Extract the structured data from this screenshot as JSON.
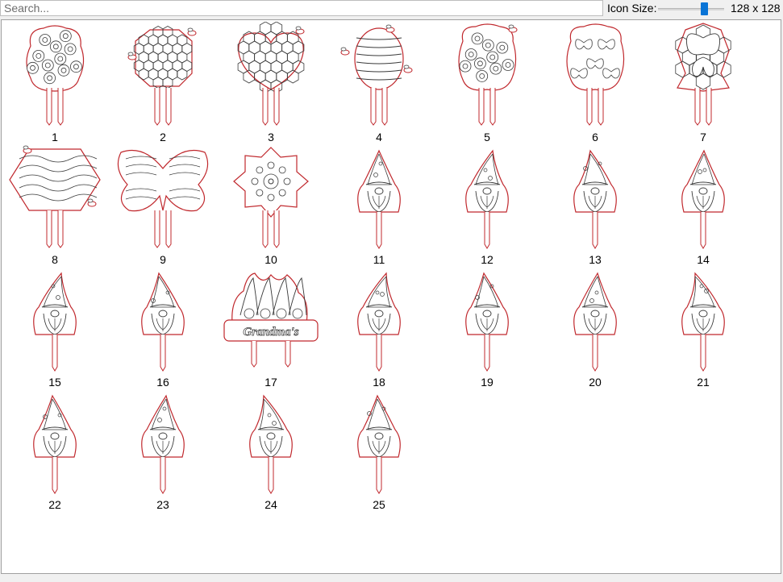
{
  "search": {
    "placeholder": "Search...",
    "value": ""
  },
  "icon_size": {
    "label": "Icon Size:",
    "value_text": "128 x 128",
    "slider_fraction": 0.73
  },
  "stroke_colors": {
    "outer": "#c0282d",
    "inner": "#3a3a3a"
  },
  "items": [
    {
      "label": "1",
      "icon": "sunflower-bouquet-stake"
    },
    {
      "label": "2",
      "icon": "honeycomb-bee-stake"
    },
    {
      "label": "3",
      "icon": "honeycomb-heart-stake"
    },
    {
      "label": "4",
      "icon": "beehive-stake"
    },
    {
      "label": "5",
      "icon": "flower-cluster-stake"
    },
    {
      "label": "6",
      "icon": "butterfly-bouquet-stake"
    },
    {
      "label": "7",
      "icon": "butterfly-honeycomb-stake"
    },
    {
      "label": "8",
      "icon": "hexagon-pattern-stake"
    },
    {
      "label": "9",
      "icon": "butterfly-stake"
    },
    {
      "label": "10",
      "icon": "mandala-flower-stake"
    },
    {
      "label": "11",
      "icon": "gnome-love-stake"
    },
    {
      "label": "12",
      "icon": "gnome-tall-hat-stake"
    },
    {
      "label": "13",
      "icon": "gnome-stake"
    },
    {
      "label": "14",
      "icon": "gnome-flower-stake"
    },
    {
      "label": "15",
      "icon": "gnome-stake"
    },
    {
      "label": "16",
      "icon": "gnome-dotted-hat-stake"
    },
    {
      "label": "17",
      "icon": "gnomes-grandmas-stake"
    },
    {
      "label": "18",
      "icon": "gnome-sunglasses-stake"
    },
    {
      "label": "19",
      "icon": "gnome-flag-stake"
    },
    {
      "label": "20",
      "icon": "gnome-waving-stake"
    },
    {
      "label": "21",
      "icon": "gnome-chef-stake"
    },
    {
      "label": "22",
      "icon": "gnome-stake"
    },
    {
      "label": "23",
      "icon": "gnome-dancing-stake"
    },
    {
      "label": "24",
      "icon": "gnome-key-stake"
    },
    {
      "label": "25",
      "icon": "gnome-witch-hat-stake"
    }
  ]
}
